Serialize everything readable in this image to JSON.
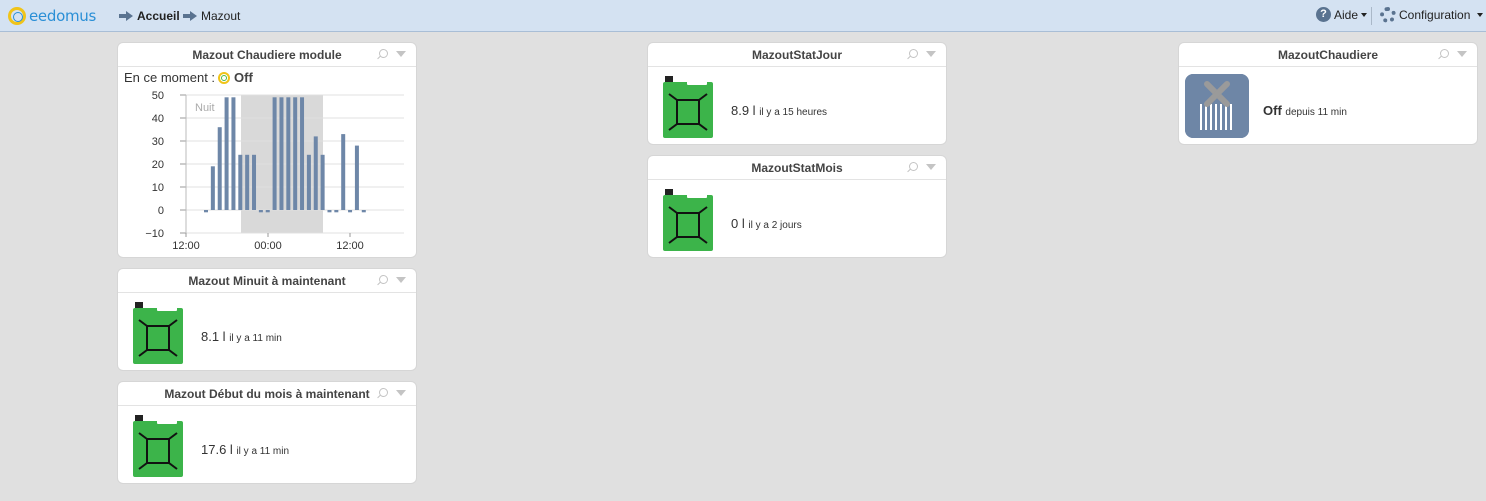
{
  "topbar": {
    "logo_text": "eedomus",
    "breadcrumb": [
      {
        "label": "Accueil"
      },
      {
        "label": "Mazout"
      }
    ],
    "help_label": "Aide",
    "config_label": "Configuration"
  },
  "widgets": {
    "chaudiere_module": {
      "title": "Mazout Chaudiere module",
      "status_prefix": "En ce moment :",
      "status_value": "Off",
      "chart_data": {
        "type": "bar",
        "title": "",
        "xlabel": "",
        "ylabel": "",
        "ylim": [
          -10,
          50
        ],
        "yticks": [
          50,
          40,
          30,
          20,
          10,
          0,
          -10
        ],
        "xticks": [
          "12:00",
          "00:00",
          "12:00"
        ],
        "band_label": "Nuit",
        "color": "#6e87a8",
        "values": [
          -1,
          19,
          36,
          49,
          49,
          24,
          24,
          24,
          -1,
          -1,
          49,
          49,
          49,
          49,
          49,
          24,
          32,
          24,
          -1,
          -1,
          33,
          -1,
          28,
          -1
        ]
      }
    },
    "minuit": {
      "title": "Mazout Minuit à maintenant",
      "value": "8.1 l",
      "since": "il y a 11 min"
    },
    "debut_mois": {
      "title": "Mazout Début du mois à maintenant",
      "value": "17.6 l",
      "since": "il y a 11 min"
    },
    "stat_jour": {
      "title": "MazoutStatJour",
      "value": "8.9 l",
      "since": "il y a 15 heures"
    },
    "stat_mois": {
      "title": "MazoutStatMois",
      "value": "0 l",
      "since": "il y a 2 jours"
    },
    "chaudiere": {
      "title": "MazoutChaudiere",
      "value": "Off",
      "since": "depuis 11 min"
    }
  },
  "colors": {
    "accent": "#2a8fd6",
    "topbar": "#d4e2f2",
    "can_green": "#3cb44a",
    "bar": "#6e87a8"
  }
}
